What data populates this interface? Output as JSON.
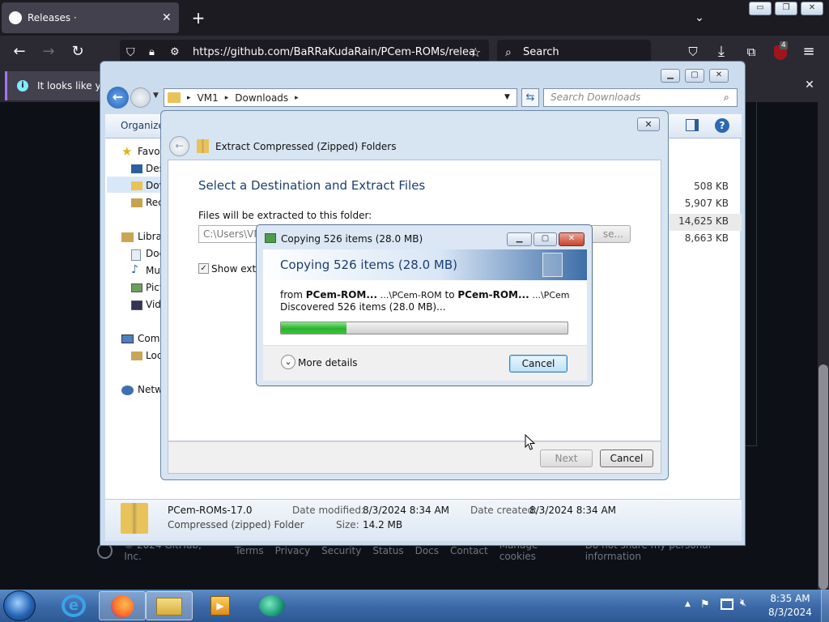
{
  "firefox": {
    "tab_title": "Releases · BaRRaKudaRain/PCem",
    "url": "https://github.com/BaRRaKudaRain/PCem-ROMs/relea",
    "search_placeholder": "Search",
    "ublock_badge": "4",
    "notification_text": "It looks like you",
    "window_min": "▭",
    "window_restore": "❐",
    "window_close": "✕"
  },
  "github_footer": {
    "copyright": "© 2024 GitHub, Inc.",
    "links": [
      "Terms",
      "Privacy",
      "Security",
      "Status",
      "Docs",
      "Contact",
      "Manage cookies",
      "Do not share my personal information"
    ]
  },
  "explorer": {
    "breadcrumb": [
      "VM1",
      "Downloads"
    ],
    "search_placeholder": "Search Downloads",
    "organize_label": "Organize",
    "nav": [
      "Favor",
      "Des",
      "Dov",
      "Rec",
      "Libra",
      "Doc",
      "Mu",
      "Pict",
      "Vid",
      "Com",
      "Loc",
      "Netw"
    ],
    "sizes": [
      "508 KB",
      "5,907 KB",
      "14,625 KB",
      "8,663 KB"
    ],
    "details": {
      "name": "PCem-ROMs-17.0",
      "type": "Compressed (zipped) Folder",
      "date_modified_label": "Date modified:",
      "date_modified": "8/3/2024 8:34 AM",
      "size_label": "Size:",
      "size": "14.2 MB",
      "date_created_label": "Date created:",
      "date_created": "8/3/2024 8:34 AM"
    }
  },
  "wizard": {
    "title": "Extract Compressed (Zipped) Folders",
    "heading": "Select a Destination and Extract Files",
    "folder_label": "Files will be extracted to this folder:",
    "folder_value": "C:\\Users\\VM",
    "browse_label": "se...",
    "show_label": "Show extra",
    "next_label": "Next",
    "cancel_label": "Cancel"
  },
  "copy_dialog": {
    "title": "Copying 526 items (28.0 MB)",
    "banner": "Copying 526 items (28.0 MB)",
    "from_prefix": "from",
    "from_name": "PCem-ROM...",
    "from_path": "...\\PCem-ROM",
    "to_word": "to",
    "to_name": "PCem-ROM...",
    "to_path": "...\\PCem-ROM",
    "discovered": "Discovered 526 items (28.0 MB)...",
    "progress_fraction": 0.23,
    "more_details": "More details",
    "cancel_label": "Cancel"
  },
  "taskbar": {
    "time": "8:35 AM",
    "date": "8/3/2024"
  }
}
